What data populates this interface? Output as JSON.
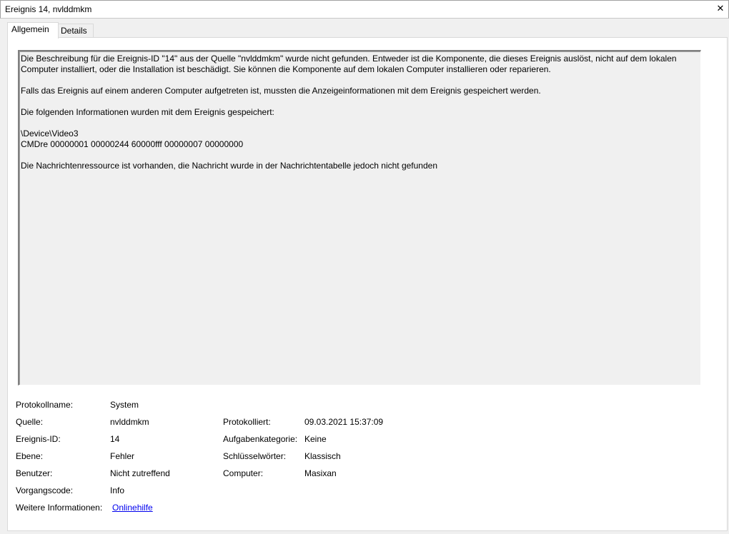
{
  "window": {
    "title": "Ereignis 14, nvlddmkm",
    "close_glyph": "✕"
  },
  "tabs": [
    {
      "label": "Allgemein",
      "active": true
    },
    {
      "label": "Details",
      "active": false
    }
  ],
  "description": {
    "p1": "Die Beschreibung für die Ereignis-ID \"14\" aus der Quelle \"nvlddmkm\" wurde nicht gefunden. Entweder ist die Komponente, die dieses Ereignis auslöst, nicht auf dem lokalen Computer installiert, oder die Installation ist beschädigt. Sie können die Komponente auf dem lokalen Computer installieren oder reparieren.",
    "p2": "Falls das Ereignis auf einem anderen Computer aufgetreten ist, mussten die Anzeigeinformationen mit dem Ereignis gespeichert werden.",
    "p3": "Die folgenden Informationen wurden mit dem Ereignis gespeichert:",
    "p4_line1": "\\Device\\Video3",
    "p4_line2": "CMDre 00000001 00000244 60000fff 00000007 00000000",
    "p5": "Die Nachrichtenressource ist vorhanden, die Nachricht wurde in der Nachrichtentabelle jedoch nicht gefunden"
  },
  "properties": {
    "log_name": {
      "label": "Protokollname:",
      "value": "System"
    },
    "source": {
      "label": "Quelle:",
      "value": "nvlddmkm"
    },
    "logged": {
      "label": "Protokolliert:",
      "value": "09.03.2021 15:37:09"
    },
    "event_id": {
      "label": "Ereignis-ID:",
      "value": "14"
    },
    "task_category": {
      "label": "Aufgabenkategorie:",
      "value": "Keine"
    },
    "level": {
      "label": "Ebene:",
      "value": "Fehler"
    },
    "keywords": {
      "label": "Schlüsselwörter:",
      "value": "Klassisch"
    },
    "user": {
      "label": "Benutzer:",
      "value": "Nicht zutreffend"
    },
    "computer": {
      "label": "Computer:",
      "value": "Masixan"
    },
    "opcode": {
      "label": "Vorgangscode:",
      "value": "Info"
    },
    "more_info": {
      "label": "Weitere Informationen:",
      "value": "Onlinehilfe"
    }
  }
}
